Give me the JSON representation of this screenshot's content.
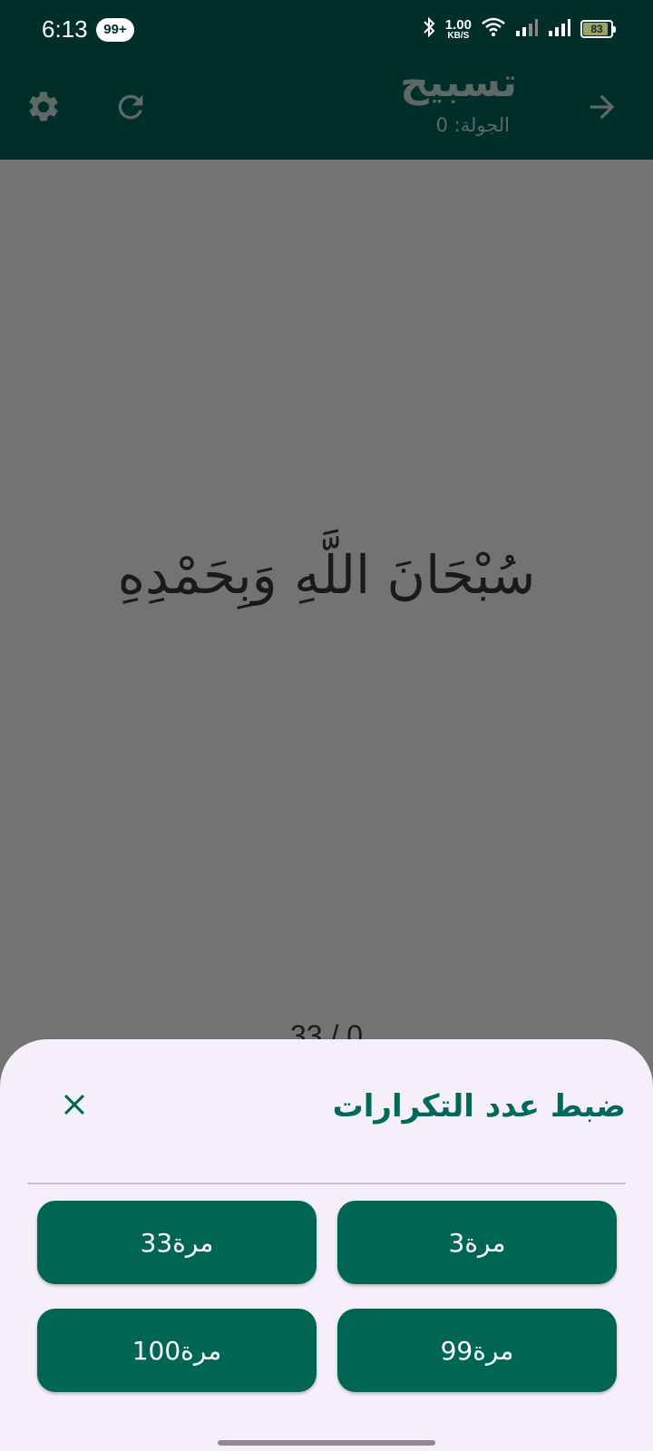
{
  "status_bar": {
    "time": "6:13",
    "notification_badge": "99+",
    "net_speed_value": "1.00",
    "net_speed_unit": "KB/S",
    "battery_level": "83",
    "icons": [
      "bluetooth-icon",
      "wifi-icon",
      "signal-icon",
      "signal-icon",
      "battery-icon"
    ]
  },
  "app_bar": {
    "title": "تسبيح",
    "round_label": "الجولة: 0",
    "icons": [
      "settings-icon",
      "refresh-icon",
      "arrow-forward-icon"
    ]
  },
  "content": {
    "dhikr": "سُبْحَانَ اللَّهِ وَبِحَمْدِهِ",
    "counter": "33 / 0"
  },
  "sheet": {
    "title": "ضبط عدد التكرارات",
    "close_icon": "close-icon",
    "options": [
      "3مرة",
      "33مرة",
      "99مرة",
      "100مرة"
    ]
  },
  "colors": {
    "app_bar_bg": "#002e29",
    "accent": "#006654",
    "sheet_bg": "#f4eff8",
    "scrim": "#737373"
  }
}
